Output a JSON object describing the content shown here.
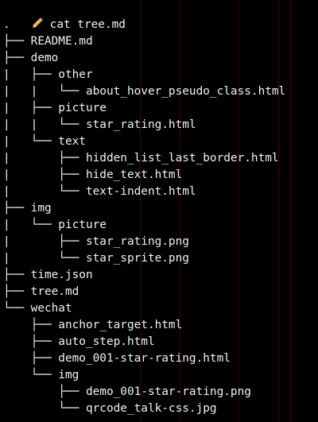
{
  "terminal": {
    "command": "cat tree.md",
    "prompt_icon": "pencil-icon",
    "colors": {
      "background": "#000000",
      "text": "#f2f2f2"
    },
    "lines": [
      ".",
      "├── README.md",
      "├── demo",
      "|   ├── other",
      "|   |   └── about_hover_pseudo_class.html",
      "|   ├── picture",
      "|   |   └── star_rating.html",
      "|   └── text",
      "|       ├── hidden_list_last_border.html",
      "|       ├── hide_text.html",
      "|       └── text-indent.html",
      "├── img",
      "|   └── picture",
      "|       ├── star_rating.png",
      "|       └── star_sprite.png",
      "├── time.json",
      "├── tree.md",
      "└── wechat",
      "    ├── anchor_target.html",
      "    ├── auto_step.html",
      "    ├── demo_001-star-rating.html",
      "    └── img",
      "        ├── demo_001-star-rating.png",
      "        └── qrcode_talk-css.jpg"
    ]
  }
}
